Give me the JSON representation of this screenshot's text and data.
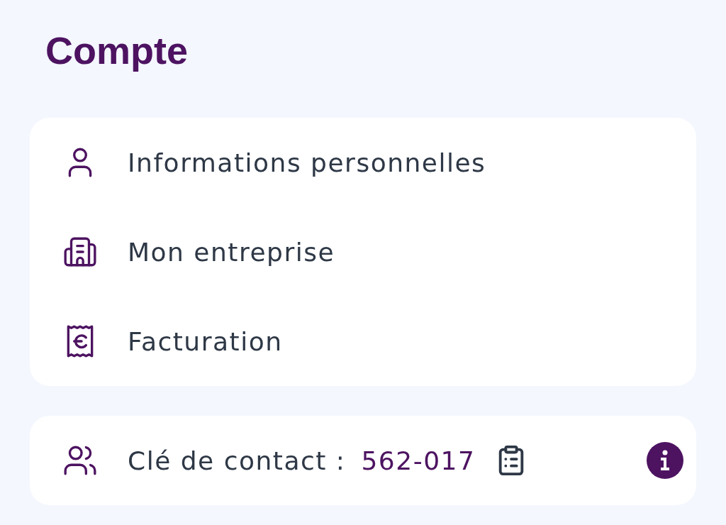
{
  "title": "Compte",
  "menu": [
    {
      "kind": "person",
      "label": "Informations personnelles"
    },
    {
      "kind": "company",
      "label": "Mon entreprise"
    },
    {
      "kind": "billing",
      "label": "Facturation"
    }
  ],
  "contact": {
    "label": "Clé de contact :",
    "value": "562-017"
  }
}
